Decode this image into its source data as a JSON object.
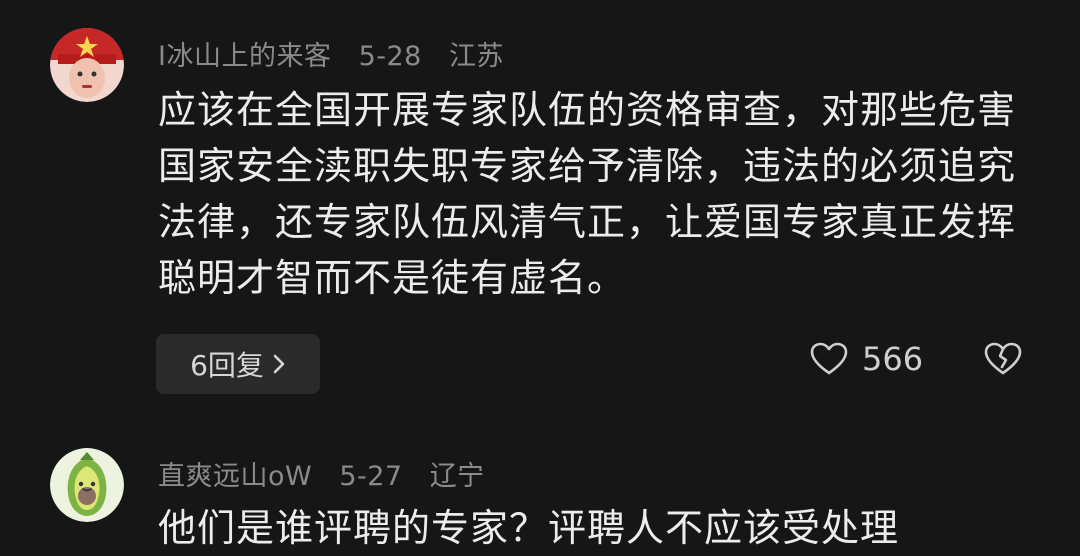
{
  "comments": [
    {
      "username": "I冰山上的来客",
      "date": "5-28",
      "location": "江苏",
      "text": "应该在全国开展专家队伍的资格审查，对那些危害国家安全渎职失职专家给予清除，违法的必须追究法律，还专家队伍风清气正，让爱国专家真正发挥聪明才智而不是徒有虚名。",
      "reply_label": "6回复",
      "like_count": "566"
    },
    {
      "username": "直爽远山oW",
      "date": "5-27",
      "location": "辽宁",
      "text": "他们是谁评聘的专家？评聘人不应该受处理"
    }
  ],
  "icons": {
    "like": "heart-icon",
    "dislike": "broken-heart-icon",
    "reply_chevron": "chevron-right-icon"
  },
  "colors": {
    "background": "#161616",
    "meta_text": "#8a8a8a",
    "body_text": "#ececec",
    "reply_bg": "#2a2a2a"
  }
}
